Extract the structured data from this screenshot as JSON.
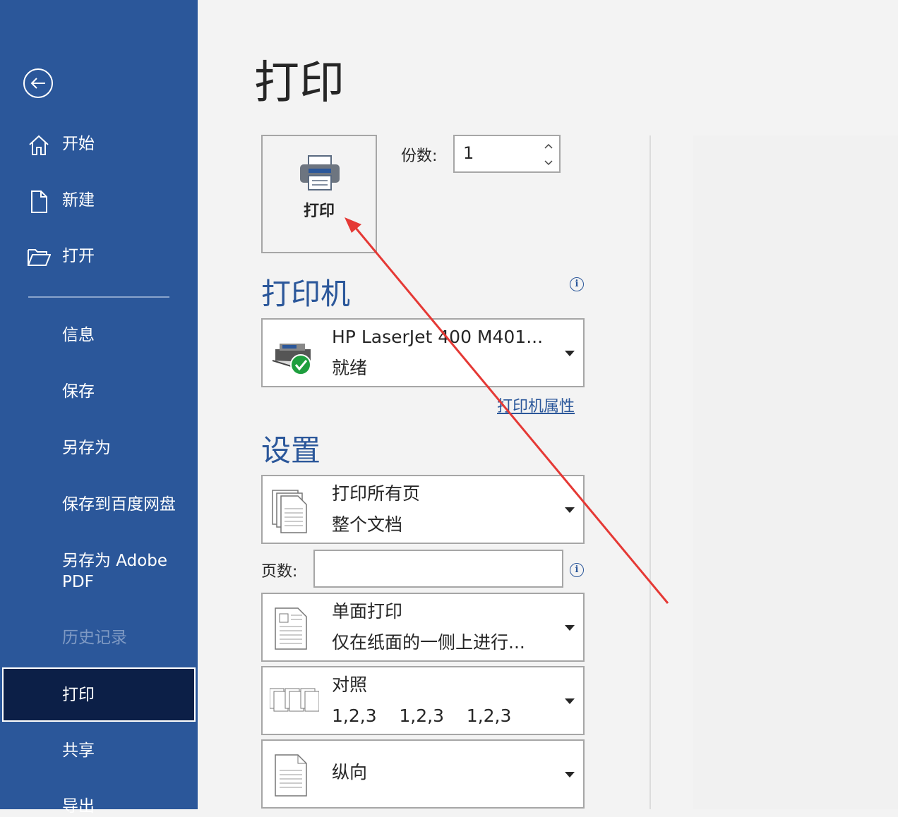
{
  "sidebar": {
    "items": [
      {
        "label": "开始",
        "icon": "home-icon"
      },
      {
        "label": "新建",
        "icon": "new-document-icon"
      },
      {
        "label": "打开",
        "icon": "folder-open-icon"
      },
      {
        "label": "信息"
      },
      {
        "label": "保存"
      },
      {
        "label": "另存为"
      },
      {
        "label": "保存到百度网盘"
      },
      {
        "label": "另存为 Adobe PDF"
      },
      {
        "label": "历史记录",
        "disabled": true
      },
      {
        "label": "打印",
        "active": true
      },
      {
        "label": "共享"
      },
      {
        "label": "导出"
      }
    ]
  },
  "main": {
    "title": "打印",
    "print_button_label": "打印",
    "copies_label": "份数:",
    "copies_value": "1",
    "printer_section_title": "打印机",
    "printer": {
      "name": "HP LaserJet 400 M401...",
      "status": "就绪"
    },
    "printer_properties_link": "打印机属性",
    "settings_section_title": "设置",
    "settings": [
      {
        "line1": "打印所有页",
        "line2": "整个文档"
      },
      {
        "line1": "单面打印",
        "line2": "仅在纸面的一侧上进行..."
      },
      {
        "line1": "对照",
        "line2": "1,2,3    1,2,3    1,2,3"
      },
      {
        "line1": "纵向"
      }
    ],
    "pages_label": "页数:",
    "pages_value": ""
  },
  "colors": {
    "sidebar_bg": "#2b579a",
    "active_bg": "#0c1f47",
    "accent": "#2b579a",
    "annotation_arrow": "#e53935"
  }
}
